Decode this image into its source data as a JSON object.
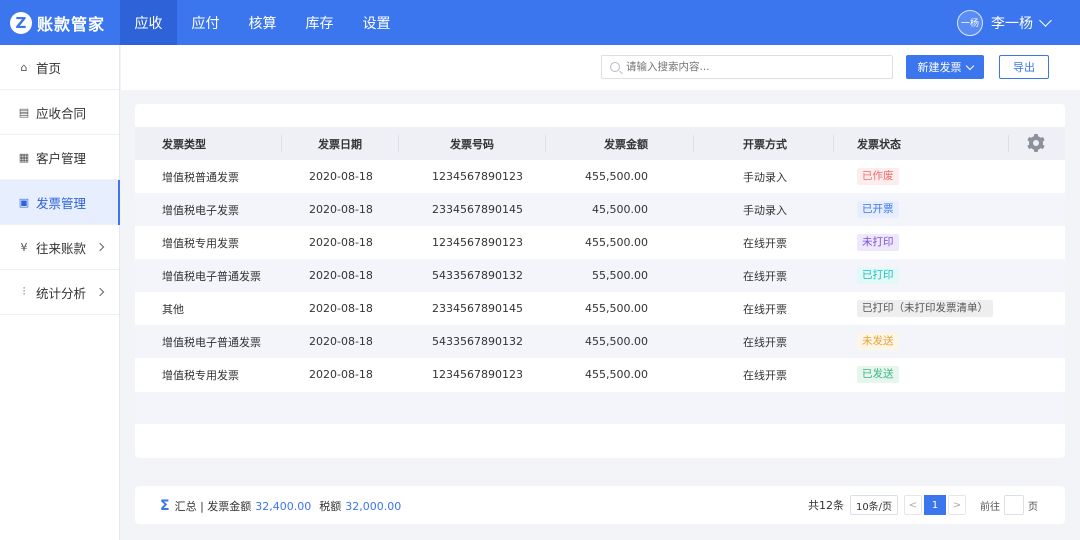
{
  "brand": {
    "logo": "Z",
    "name": "账款管家"
  },
  "topnav": [
    {
      "label": "应收",
      "active": true
    },
    {
      "label": "应付",
      "active": false
    },
    {
      "label": "核算",
      "active": false
    },
    {
      "label": "库存",
      "active": false
    },
    {
      "label": "设置",
      "active": false
    }
  ],
  "user": {
    "avatar": "一杨",
    "name": "李一杨"
  },
  "sidebar": {
    "items": [
      {
        "label": "首页",
        "icon": "home-icon"
      },
      {
        "label": "应收合同",
        "icon": "document-icon"
      },
      {
        "label": "客户管理",
        "icon": "building-icon"
      },
      {
        "label": "发票管理",
        "icon": "invoice-icon",
        "active": true
      },
      {
        "label": "往来账款",
        "icon": "yen-icon",
        "has_arrow": true
      },
      {
        "label": "统计分析",
        "icon": "chart-icon",
        "has_arrow": true
      }
    ]
  },
  "toolbar": {
    "search_placeholder": "请输入搜索内容...",
    "new_label": "新建发票",
    "export_label": "导出"
  },
  "table": {
    "columns": [
      "发票类型",
      "发票日期",
      "发票号码",
      "发票金额",
      "开票方式",
      "发票状态"
    ],
    "rows": [
      {
        "type": "增值税普通发票",
        "date": "2020-08-18",
        "number": "1234567890123",
        "amount": "455,500.00",
        "way": "手动录入",
        "status": "已作废",
        "status_color": "#f56c6c",
        "status_bg": "#fdeeee"
      },
      {
        "type": "增值税电子发票",
        "date": "2020-08-18",
        "number": "2334567890145",
        "amount": "45,500.00",
        "way": "手动录入",
        "status": "已开票",
        "status_color": "#3c76ee",
        "status_bg": "#e6eeff"
      },
      {
        "type": "增值税专用发票",
        "date": "2020-08-18",
        "number": "1234567890123",
        "amount": "455,500.00",
        "way": "在线开票",
        "status": "未打印",
        "status_color": "#7b4fd8",
        "status_bg": "#efe8fc"
      },
      {
        "type": "增值税电子普通发票",
        "date": "2020-08-18",
        "number": "5433567890132",
        "amount": "55,500.00",
        "way": "在线开票",
        "status": "已打印",
        "status_color": "#19c2bd",
        "status_bg": "#e4f8f7"
      },
      {
        "type": "其他",
        "date": "2020-08-18",
        "number": "2334567890145",
        "amount": "455,500.00",
        "way": "在线开票",
        "status": "已打印（未打印发票清单）",
        "status_color": "#555555",
        "status_bg": "#eeeeee"
      },
      {
        "type": "增值税电子普通发票",
        "date": "2020-08-18",
        "number": "5433567890132",
        "amount": "455,500.00",
        "way": "在线开票",
        "status": "未发送",
        "status_color": "#e6a23c",
        "status_bg": "#fdf5e6"
      },
      {
        "type": "增值税专用发票",
        "date": "2020-08-18",
        "number": "1234567890123",
        "amount": "455,500.00",
        "way": "在线开票",
        "status": "已发送",
        "status_color": "#3bb77e",
        "status_bg": "#e6f6ee"
      }
    ]
  },
  "footer": {
    "summary_label": "汇总 | 发票金额",
    "invoice_amount": "32,400.00",
    "tax_label": "税额",
    "tax_amount": "32,000.00",
    "total": "共12条",
    "page_size": "10条/页",
    "prev": "<",
    "current_page": "1",
    "next": ">",
    "goto_label": "前往",
    "page_unit": "页"
  }
}
